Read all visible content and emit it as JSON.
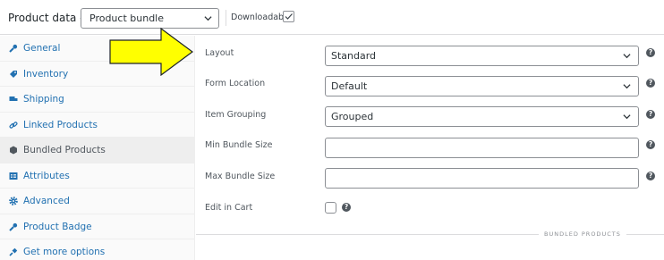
{
  "header": {
    "title": "Product data —",
    "product_type": "Product bundle",
    "downloadable_label": "Downloadable:",
    "downloadable_checked": true
  },
  "sidebar": {
    "tabs": [
      {
        "label": "General",
        "icon": "wrench-icon",
        "active": false
      },
      {
        "label": "Inventory",
        "icon": "tag-icon",
        "active": false
      },
      {
        "label": "Shipping",
        "icon": "truck-icon",
        "active": false
      },
      {
        "label": "Linked Products",
        "icon": "link-icon",
        "active": false
      },
      {
        "label": "Bundled Products",
        "icon": "hexagon-icon",
        "active": true
      },
      {
        "label": "Attributes",
        "icon": "table-icon",
        "active": false
      },
      {
        "label": "Advanced",
        "icon": "gear-icon",
        "active": false
      },
      {
        "label": "Product Badge",
        "icon": "wrench-icon",
        "active": false
      },
      {
        "label": "Get more options",
        "icon": "plugin-icon",
        "active": false
      }
    ]
  },
  "form": {
    "layout": {
      "label": "Layout",
      "value": "Standard"
    },
    "form_location": {
      "label": "Form Location",
      "value": "Default"
    },
    "item_grouping": {
      "label": "Item Grouping",
      "value": "Grouped"
    },
    "min_bundle_size": {
      "label": "Min Bundle Size",
      "value": ""
    },
    "max_bundle_size": {
      "label": "Max Bundle Size",
      "value": ""
    },
    "edit_in_cart": {
      "label": "Edit in Cart",
      "checked": false
    }
  },
  "section": {
    "bundled_products_label": "BUNDLED PRODUCTS"
  },
  "help_glyph": "?",
  "colors": {
    "link": "#2271b1",
    "arrow_fill": "#ffff00",
    "active_tab": "#eeeeee"
  }
}
